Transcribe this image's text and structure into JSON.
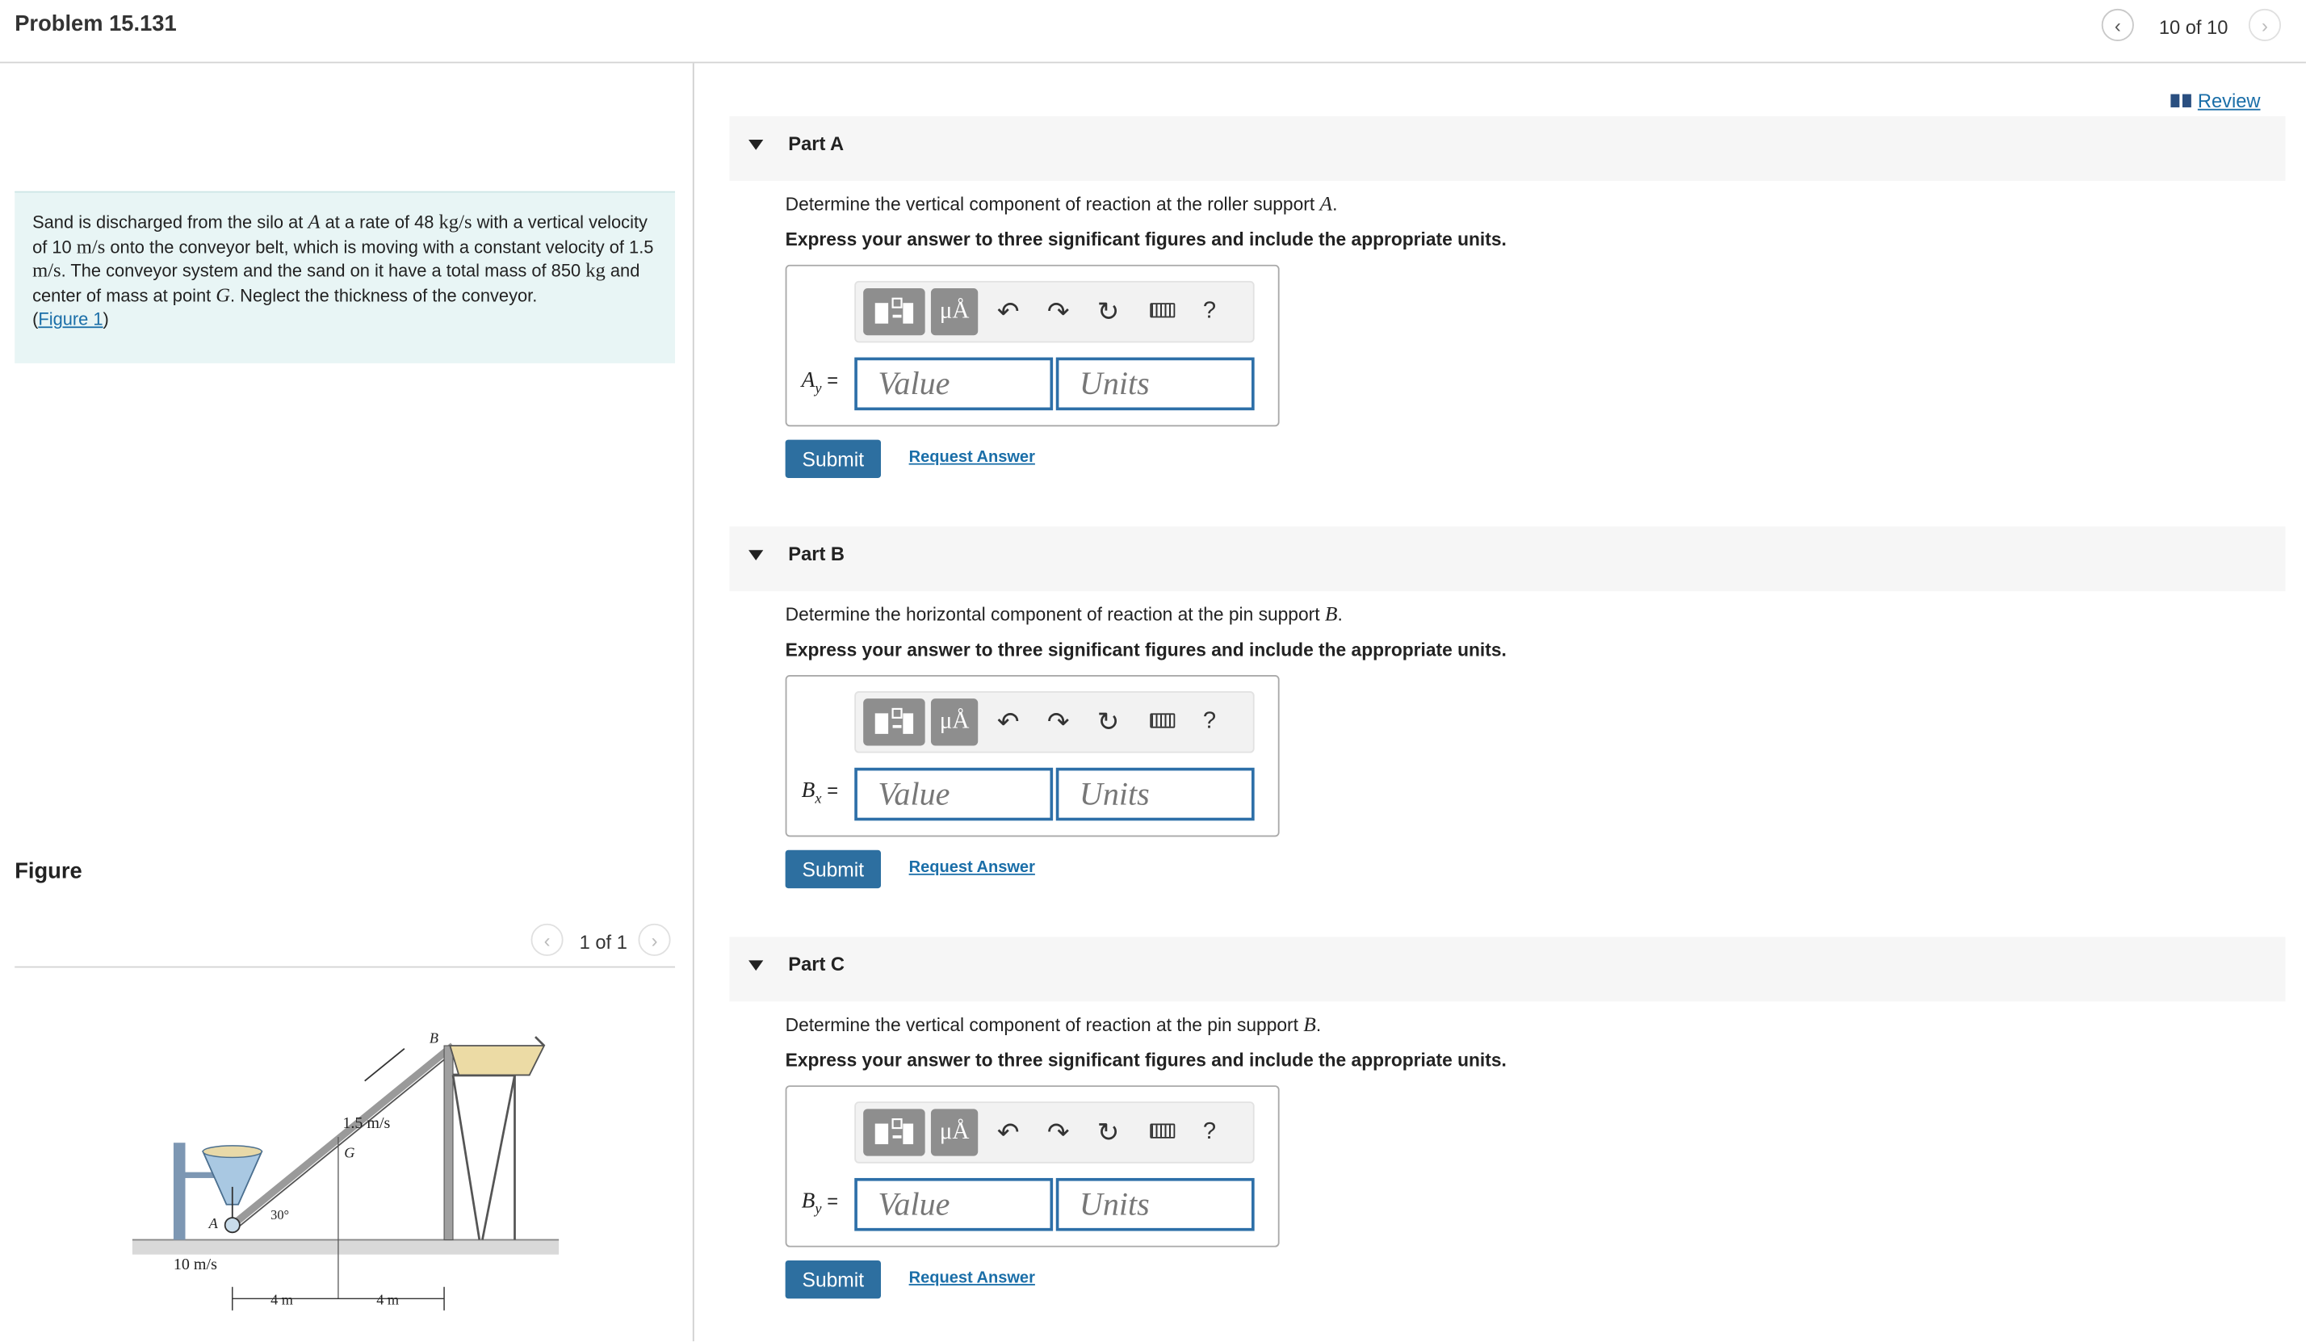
{
  "header": {
    "title": "Problem 15.131",
    "pager": "10 of 10",
    "prev_icon": "chevron-left-icon",
    "next_icon": "chevron-right-icon"
  },
  "problem": {
    "text_1": "Sand is discharged from the silo at ",
    "A": "A",
    "text_2": " at a rate of 48 ",
    "rate_units": "kg/s",
    "text_3": " with a vertical velocity of 10 ",
    "vel_units_1": "m/s",
    "text_4": " onto the conveyor belt, which is moving with a constant velocity of 1.5 ",
    "vel_units_2": "m/s",
    "text_5": ". The conveyor system and the sand on it have a total mass of 850 ",
    "mass_units": "kg",
    "text_6": " and center of mass at point ",
    "G": "G",
    "text_7": ". Neglect the thickness of the conveyor.",
    "figure_link_open": "(",
    "figure_link": "Figure 1",
    "figure_link_close": ")"
  },
  "figure": {
    "title": "Figure",
    "pager": "1 of 1",
    "labels": {
      "speed_belt": "1.5 m/s",
      "B": "B",
      "G": "G",
      "A": "A",
      "angle": "30°",
      "speed_sand": "10 m/s",
      "dim1": "4 m",
      "dim2": "4 m"
    }
  },
  "review": "Review",
  "parts": [
    {
      "label": "Part A",
      "q_text": "Determine the vertical component of reaction at the roller support ",
      "q_point": "A",
      "instruction": "Express your answer to three significant figures and include the appropriate units.",
      "var": "A",
      "var_sub": "y",
      "value_placeholder": "Value",
      "units_placeholder": "Units",
      "submit": "Submit",
      "request": "Request Answer"
    },
    {
      "label": "Part B",
      "q_text": "Determine the horizontal component of reaction at the pin support ",
      "q_point": "B",
      "instruction": "Express your answer to three significant figures and include the appropriate units.",
      "var": "B",
      "var_sub": "x",
      "value_placeholder": "Value",
      "units_placeholder": "Units",
      "submit": "Submit",
      "request": "Request Answer"
    },
    {
      "label": "Part C",
      "q_text": "Determine the vertical component of reaction at the pin support ",
      "q_point": "B",
      "instruction": "Express your answer to three significant figures and include the appropriate units.",
      "var": "B",
      "var_sub": "y",
      "value_placeholder": "Value",
      "units_placeholder": "Units",
      "submit": "Submit",
      "request": "Request Answer"
    }
  ],
  "toolbar": {
    "templates_icon": "templates-icon",
    "units_symbol": "μÅ",
    "undo_icon": "undo-icon",
    "redo_icon": "redo-icon",
    "reset_icon": "reset-icon",
    "keyboard_icon": "keyboard-icon",
    "help": "?"
  }
}
